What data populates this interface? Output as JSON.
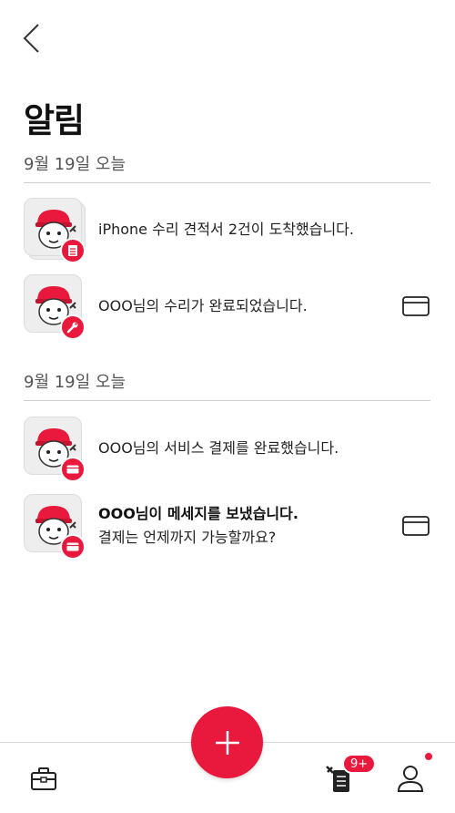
{
  "header": {
    "title": "알림"
  },
  "sections": [
    {
      "date_label": "9월 19일 오늘",
      "items": [
        {
          "text": "iPhone 수리 견적서 2건이 도착했습니다.",
          "badge_icon": "document-icon",
          "stacked": true,
          "has_card": false
        },
        {
          "text": "OOO님의 수리가 완료되었습니다.",
          "badge_icon": "wrench-icon",
          "stacked": false,
          "has_card": true
        }
      ]
    },
    {
      "date_label": "9월 19일 오늘",
      "items": [
        {
          "text": "OOO님의 서비스 결제를 완료했습니다.",
          "badge_icon": "card-icon",
          "stacked": false,
          "has_card": false
        },
        {
          "title": "OOO님이 메세지를 보냈습니다.",
          "text": "결제는 언제까지 가능할까요?",
          "badge_icon": "card-icon",
          "stacked": false,
          "has_card": true
        }
      ]
    }
  ],
  "tabbar": {
    "left_icon": "toolbox-icon",
    "center_icon": "plus-icon",
    "repair_icon": "repair-document-icon",
    "repair_badge": "9+",
    "profile_icon": "user-icon"
  },
  "colors": {
    "accent": "#e8193c",
    "divider": "#cfcfcf",
    "text": "#222222",
    "muted": "#555555"
  }
}
